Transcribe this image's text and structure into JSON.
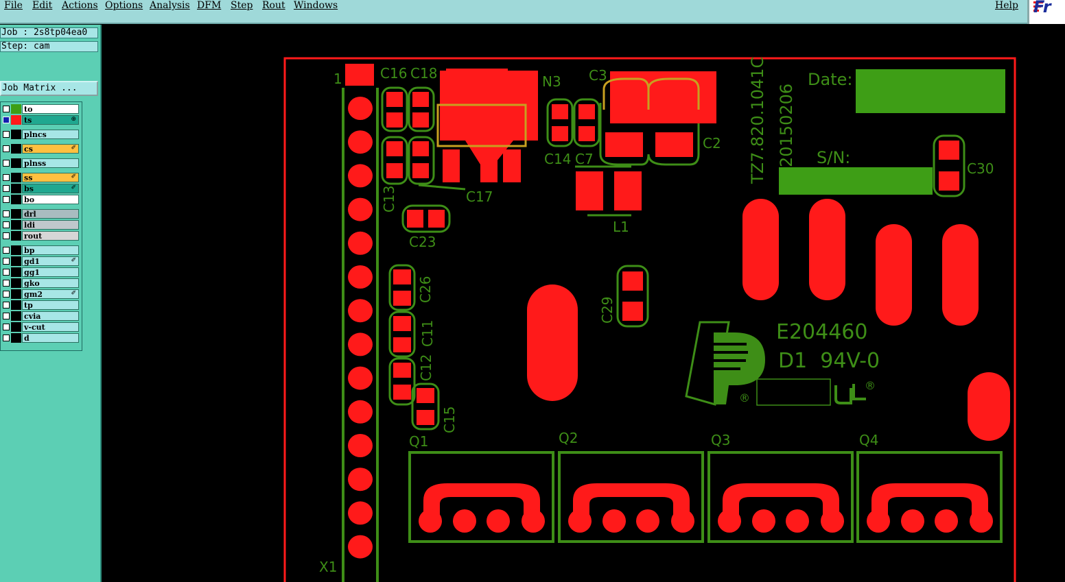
{
  "menu": {
    "items": [
      "File",
      "Edit",
      "Actions",
      "Options",
      "Analysis",
      "DFM",
      "Step",
      "Rout",
      "Windows"
    ],
    "help": "Help"
  },
  "logo": {
    "text": "Fr"
  },
  "job": {
    "label": "Job : 2s8tp04ea0",
    "step": "Step: cam",
    "matrix_button": "Job Matrix ..."
  },
  "layers": [
    {
      "name": "to",
      "color": "#3e9e16",
      "bg": "#ffffff",
      "flag": "",
      "selected": false
    },
    {
      "name": "ts",
      "color": "#ff1a1a",
      "bg": "#20a890",
      "flag": "⊕",
      "selected": true
    },
    {
      "name": "plncs",
      "color": "#000",
      "bg": "#a7e6e6",
      "flag": "",
      "selected": false
    },
    {
      "name": "cs",
      "color": "#000",
      "bg": "#ffc040",
      "flag": "✐",
      "selected": false
    },
    {
      "name": "plnss",
      "color": "#000",
      "bg": "#a7e6e6",
      "flag": "",
      "selected": false
    },
    {
      "name": "ss",
      "color": "#000",
      "bg": "#ffc040",
      "flag": "✐",
      "selected": false
    },
    {
      "name": "bs",
      "color": "#000",
      "bg": "#20a890",
      "flag": "✐",
      "selected": false
    },
    {
      "name": "bo",
      "color": "#000",
      "bg": "#ffffff",
      "flag": "",
      "selected": false
    },
    {
      "name": "drl",
      "color": "#000",
      "bg": "#a9bcc0",
      "flag": "",
      "selected": false
    },
    {
      "name": "ldi",
      "color": "#000",
      "bg": "#c0c8cc",
      "flag": "",
      "selected": false
    },
    {
      "name": "rout",
      "color": "#000",
      "bg": "#d6d6d6",
      "flag": "",
      "selected": false
    },
    {
      "name": "bp",
      "color": "#000",
      "bg": "#a7e6e6",
      "flag": "",
      "selected": false
    },
    {
      "name": "gd1",
      "color": "#000",
      "bg": "#a7e6e6",
      "flag": "✐",
      "selected": false
    },
    {
      "name": "gg1",
      "color": "#000",
      "bg": "#a7e6e6",
      "flag": "",
      "selected": false
    },
    {
      "name": "gko",
      "color": "#000",
      "bg": "#a7e6e6",
      "flag": "",
      "selected": false
    },
    {
      "name": "gm2",
      "color": "#000",
      "bg": "#a7e6e6",
      "flag": "✐",
      "selected": false
    },
    {
      "name": "tp",
      "color": "#000",
      "bg": "#a7e6e6",
      "flag": "",
      "selected": false
    },
    {
      "name": "cvia",
      "color": "#000",
      "bg": "#a7e6e6",
      "flag": "",
      "selected": false
    },
    {
      "name": "v-cut",
      "color": "#000",
      "bg": "#a7e6e6",
      "flag": "",
      "selected": false
    },
    {
      "name": "d",
      "color": "#000",
      "bg": "#a7e6e6",
      "flag": "",
      "selected": false
    }
  ],
  "board": {
    "colors": {
      "copper": "#ff1a1a",
      "silk": "#3e8e17",
      "outline": "#ff1a1a"
    },
    "labels": {
      "pin1": "1",
      "c16": "C16",
      "c18": "C18",
      "n3": "N3",
      "c3": "C3",
      "c14": "C14",
      "c7": "C7",
      "c2": "C2",
      "c13": "C13",
      "c17": "C17",
      "l1": "L1",
      "c23": "C23",
      "c26": "C26",
      "c11": "C11",
      "c12": "C12",
      "c15": "C15",
      "c29": "C29",
      "c30": "C30",
      "q1": "Q1",
      "q2": "Q2",
      "q3": "Q3",
      "q4": "Q4",
      "x1": "X1",
      "part_no": "TZ7.820.1041C",
      "date_code": "20150206",
      "date": "Date:",
      "sn": "S/N:",
      "ul_no": "E204460",
      "rating": "D1  94V-0",
      "reg": "®"
    }
  }
}
